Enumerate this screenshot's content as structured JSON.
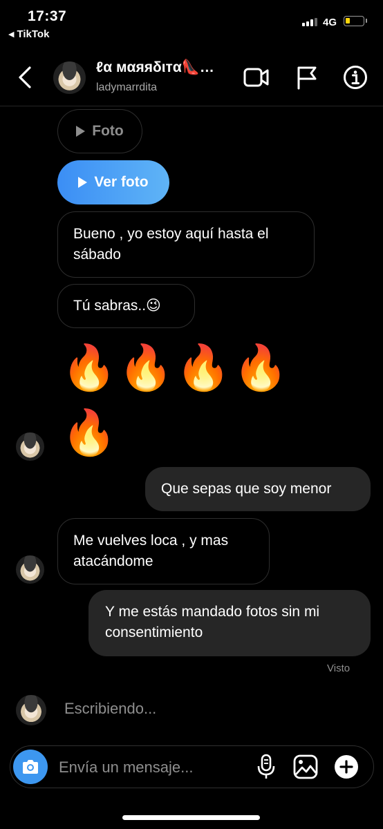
{
  "status_bar": {
    "time": "17:37",
    "back_app_label": "TikTok",
    "network": "4G",
    "battery_level": 0.2
  },
  "header": {
    "display_name": "ℓα мαяяδιтα👠…",
    "username": "ladymarrdita"
  },
  "messages": {
    "foto_label": "Foto",
    "ver_foto_label": "Ver foto",
    "m1": "Bueno , yo estoy aquí hasta el sábado",
    "m2": "Tú sabras..😉",
    "fire_row": "🔥",
    "m3": "Que sepas que soy menor",
    "m4": "Me vuelves loca , y mas atacándome",
    "m5": "Y me estás mandado fotos sin mi consentimiento"
  },
  "seen_label": "Visto",
  "typing_label": "Escribiendo...",
  "composer": {
    "placeholder": "Envía un mensaje..."
  },
  "colors": {
    "background": "#000000",
    "sent_bubble": "#262626",
    "accent_blue": "#3d97f0",
    "muted_text": "#8e8e8e"
  }
}
